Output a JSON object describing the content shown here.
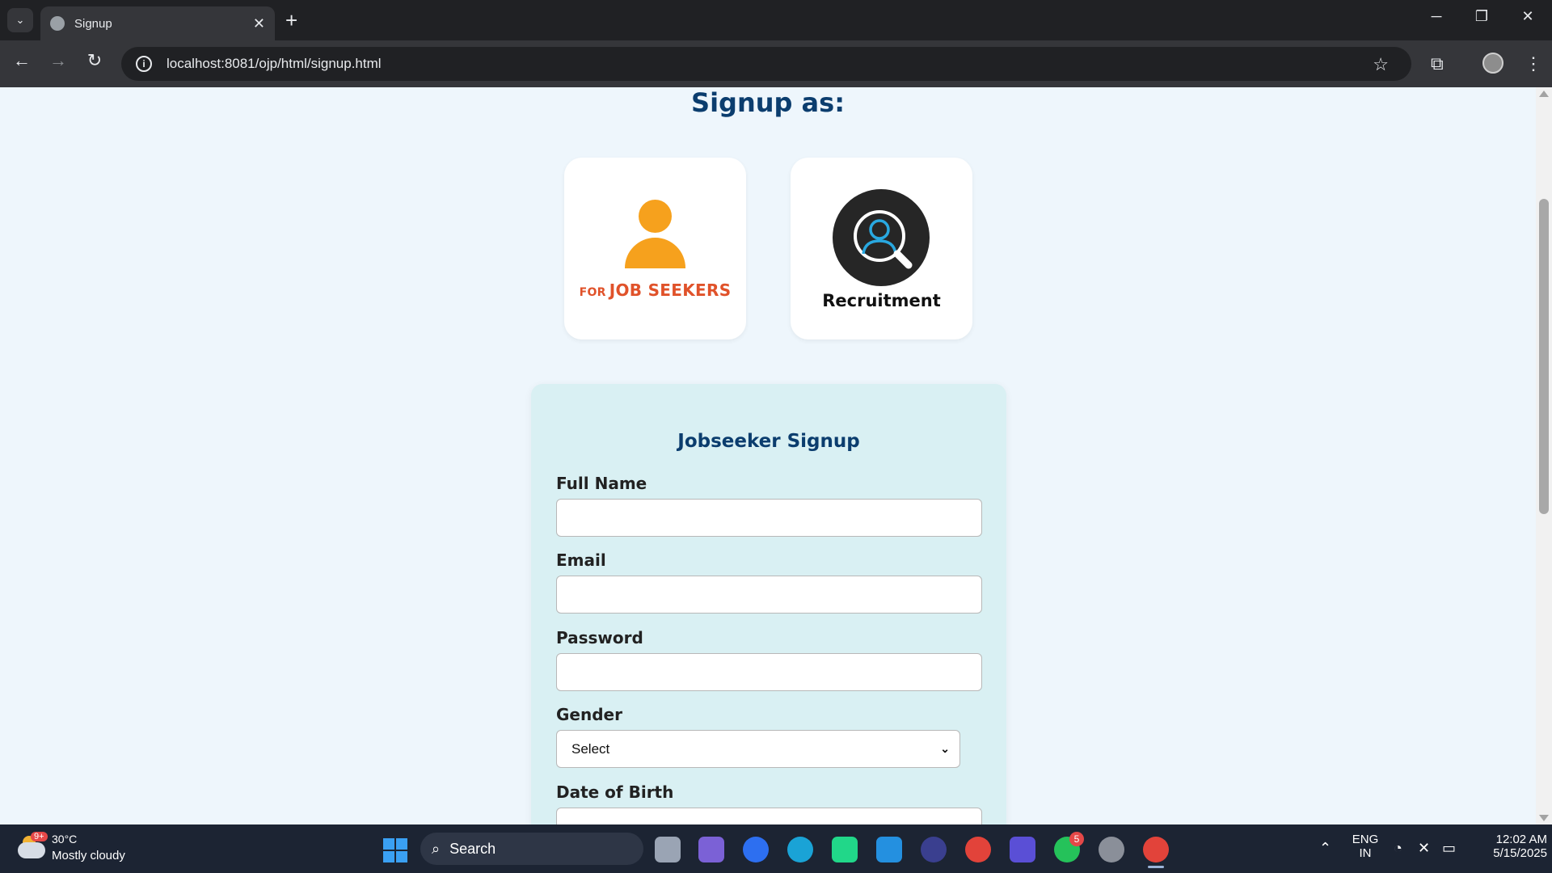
{
  "browser": {
    "tab_title": "Signup",
    "url": "localhost:8081/ojp/html/signup.html"
  },
  "page": {
    "heading": "Signup as:",
    "roles": [
      {
        "label": "JOB SEEKERS",
        "prefix": "FOR",
        "accent": "#f6a11d",
        "label_color": "#e0522a"
      },
      {
        "label": "Recruitment",
        "accent": "#29a8e0"
      }
    ],
    "form": {
      "title": "Jobseeker Signup",
      "fields": [
        {
          "label": "Full Name",
          "value": ""
        },
        {
          "label": "Email",
          "value": ""
        },
        {
          "label": "Password",
          "value": ""
        },
        {
          "label": "Gender",
          "selected": "Select"
        },
        {
          "label": "Date of Birth",
          "value": ""
        }
      ]
    },
    "colors": {
      "heading": "#0b3d6e",
      "background": "#eef6fc",
      "form_bg": "#d9f0f3"
    }
  },
  "taskbar": {
    "weather_temp": "30°C",
    "weather_cond": "Mostly cloudy",
    "weather_badge": "9+",
    "search_label": "Search",
    "whatsapp_badge": "5",
    "lang_1": "ENG",
    "lang_2": "IN",
    "time": "12:02 AM",
    "date": "5/15/2025"
  }
}
